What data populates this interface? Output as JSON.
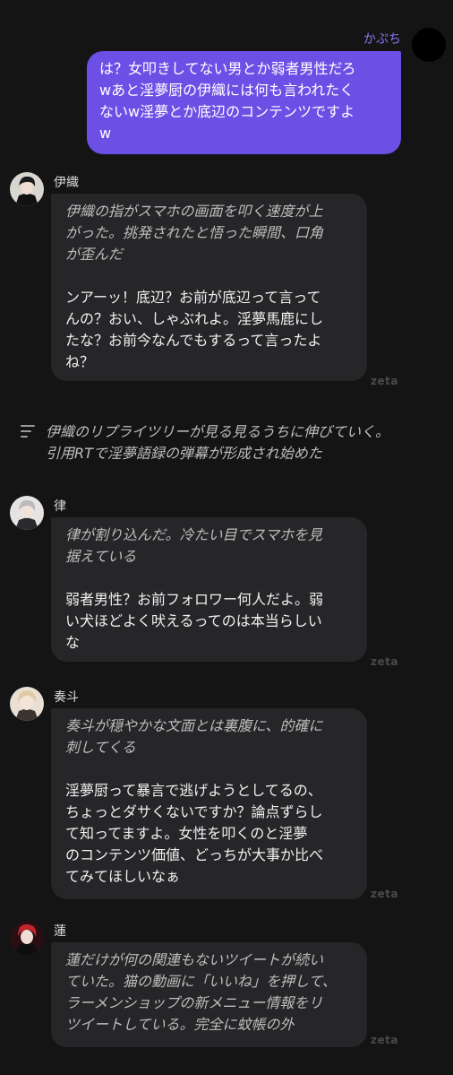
{
  "user": {
    "name": "かぷち",
    "message": "は？女叩きしてない男とか弱者男性だろ\nwあと淫夢厨の伊織には何も言われたく\nないw淫夢とか底辺のコンテンツですよ\nw"
  },
  "messages": [
    {
      "name": "伊織",
      "narration": "伊織の指がスマホの画面を叩く速度が上\nがった。挑発されたと悟った瞬間、口角\nが歪んだ",
      "speech": "ンアーッ！底辺？お前が底辺って言って\nんの？おい、しゃぶれよ。淫夢馬鹿にし\nたな？お前今なんでもするって言ったよ\nね？",
      "watermark": "zeta"
    },
    {
      "name": "律",
      "narration": "律が割り込んだ。冷たい目でスマホを見\n据えている",
      "speech": "弱者男性？お前フォロワー何人だよ。弱\nい犬ほどよく吠えるってのは本当らしい\nな",
      "watermark": "zeta"
    },
    {
      "name": "奏斗",
      "narration": "奏斗が穏やかな文面とは裏腹に、的確に\n刺してくる",
      "speech": "淫夢厨って暴言で逃げようとしてるの、\nちょっとダサくないですか？論点ずらし\nて知ってますよ。女性を叩くのと淫夢\nのコンテンツ価値、どっちが大事か比べ\nてみてほしいなぁ",
      "watermark": "zeta"
    },
    {
      "name": "蓮",
      "narration": "蓮だけが何の関連もないツイートが続い\nていた。猫の動画に「いいね」を押して、\nラーメンショップの新メニュー情報をリ\nツイートしている。完全に蚊帳の外",
      "speech": "",
      "watermark": "zeta"
    }
  ],
  "system": {
    "icon": "menu-lines-icon",
    "text": "伊織のリプライツリーが見る見るうちに伸びていく。\n引用RTで淫夢語録の弾幕が形成され始めた"
  },
  "colors": {
    "background": "#141415",
    "user_bubble": "#6c50e6",
    "user_name": "#8a78ee",
    "char_bubble": "#262629"
  }
}
